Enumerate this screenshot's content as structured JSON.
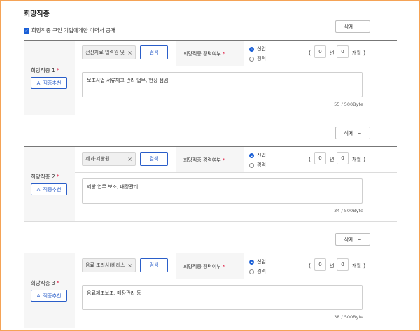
{
  "page": {
    "title": "희망직종",
    "public_checkbox_label": "희망직종 구인 기업에게만 이력서 공개",
    "public_checked": true
  },
  "delete_label": "삭제",
  "delete_icon": "minus-icon",
  "ai_button_label": "AI 직종추천",
  "search_button_label": "검색",
  "experience_label": "희망직종 경력여부",
  "radio_new": "신입",
  "radio_experienced": "경력",
  "years_unit": "년",
  "months_unit": "개월",
  "paren_open": "(",
  "paren_close": ")",
  "sections": [
    {
      "label": "희망직종 1",
      "tag": "전산자료 입력원 및",
      "experience": "신입",
      "years": "0",
      "months": "0",
      "description": "보조사업 서류체크 관리 업무, 현장 점검,",
      "byte_count": "55 / 500Byte"
    },
    {
      "label": "희망직종 2",
      "tag": "제과·제빵원",
      "experience": "신입",
      "years": "0",
      "months": "0",
      "description": "제빵 업무 보조, 매장관리",
      "byte_count": "34 / 500Byte"
    },
    {
      "label": "희망직종 3",
      "tag": "음료 조리사(바리스",
      "experience": "신입",
      "years": "0",
      "months": "0",
      "description": "음료제조보조, 매장관리 등",
      "byte_count": "38 / 500Byte"
    }
  ]
}
